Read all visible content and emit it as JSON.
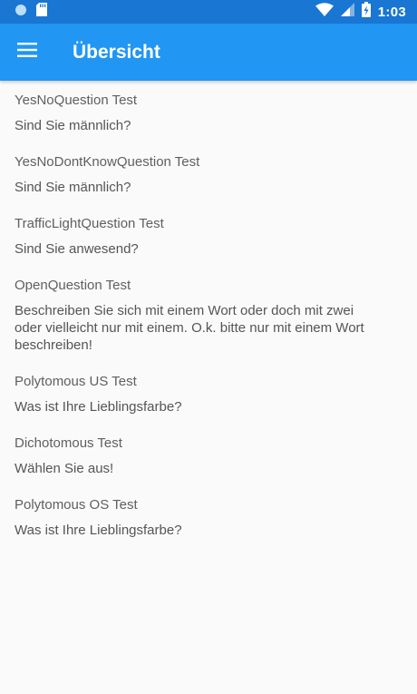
{
  "status_bar": {
    "time": "1:03",
    "icons": [
      "circle-icon",
      "sd-card-icon",
      "wifi-icon",
      "signal-icon",
      "battery-charging-icon"
    ]
  },
  "app_bar": {
    "title": "Übersicht",
    "menu_icon": "menu-icon"
  },
  "colors": {
    "status_bar": "#1976d2",
    "app_bar": "#2196f3",
    "background": "#fafafa"
  },
  "list": {
    "items": [
      {
        "title": "YesNoQuestion Test",
        "question": "Sind Sie männlich?"
      },
      {
        "title": "YesNoDontKnowQuestion Test",
        "question": "Sind Sie männlich?"
      },
      {
        "title": "TrafficLightQuestion Test",
        "question": "Sind Sie anwesend?"
      },
      {
        "title": "OpenQuestion Test",
        "question": "Beschreiben Sie sich mit einem Wort oder doch mit zwei oder vielleicht nur mit einem. O.k. bitte nur mit einem Wort beschreiben!"
      },
      {
        "title": "Polytomous US Test",
        "question": "Was ist Ihre Lieblingsfarbe?"
      },
      {
        "title": "Dichotomous Test",
        "question": "Wählen Sie aus!"
      },
      {
        "title": "Polytomous OS Test",
        "question": "Was ist Ihre Lieblingsfarbe?"
      }
    ]
  }
}
